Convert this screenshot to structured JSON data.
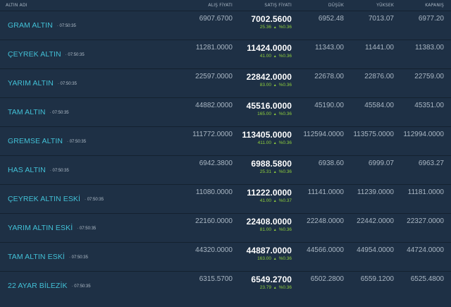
{
  "header": {
    "name": "ALTIN ADI",
    "buy": "ALIŞ FİYATI",
    "sell": "SATIŞ FİYATI",
    "low": "DÜŞÜK",
    "high": "YÜKSEK",
    "close": "KAPANIŞ"
  },
  "colors": {
    "background": "#1e3045",
    "name": "#42c0d6",
    "change": "#8fcf3c"
  },
  "change_icon": "triangle-up-icon",
  "rows": [
    {
      "name": "GRAM ALTIN",
      "time": "· 07:50:35",
      "buy": "6907.6700",
      "sell": "7002.5600",
      "change": "25.36",
      "pct": "%0.36",
      "low": "6952.48",
      "high": "7013.07",
      "close": "6977.20"
    },
    {
      "name": "ÇEYREK ALTIN",
      "time": "· 07:50:35",
      "buy": "11281.0000",
      "sell": "11424.0000",
      "change": "41.00",
      "pct": "%0.36",
      "low": "11343.00",
      "high": "11441.00",
      "close": "11383.00"
    },
    {
      "name": "YARIM ALTIN",
      "time": "· 07:50:35",
      "buy": "22597.0000",
      "sell": "22842.0000",
      "change": "83.00",
      "pct": "%0.36",
      "low": "22678.00",
      "high": "22876.00",
      "close": "22759.00"
    },
    {
      "name": "TAM ALTIN",
      "time": "· 07:50:35",
      "buy": "44882.0000",
      "sell": "45516.0000",
      "change": "165.00",
      "pct": "%0.36",
      "low": "45190.00",
      "high": "45584.00",
      "close": "45351.00"
    },
    {
      "name": "GREMSE ALTIN",
      "time": "· 07:50:35",
      "buy": "111772.0000",
      "sell": "113405.0000",
      "change": "411.00",
      "pct": "%0.36",
      "low": "112594.0000",
      "high": "113575.0000",
      "close": "112994.0000"
    },
    {
      "name": "HAS ALTIN",
      "time": "· 07:50:35",
      "buy": "6942.3800",
      "sell": "6988.5800",
      "change": "25.31",
      "pct": "%0.36",
      "low": "6938.60",
      "high": "6999.07",
      "close": "6963.27"
    },
    {
      "name": "ÇEYREK ALTIN ESKİ",
      "time": "· 07:50:35",
      "buy": "11080.0000",
      "sell": "11222.0000",
      "change": "41.00",
      "pct": "%0.37",
      "low": "11141.0000",
      "high": "11239.0000",
      "close": "11181.0000"
    },
    {
      "name": "YARIM ALTIN ESKİ",
      "time": "· 07:50:35",
      "buy": "22160.0000",
      "sell": "22408.0000",
      "change": "81.00",
      "pct": "%0.36",
      "low": "22248.0000",
      "high": "22442.0000",
      "close": "22327.0000"
    },
    {
      "name": "TAM ALTIN ESKİ",
      "time": "· 07:50:35",
      "buy": "44320.0000",
      "sell": "44887.0000",
      "change": "163.00",
      "pct": "%0.36",
      "low": "44566.0000",
      "high": "44954.0000",
      "close": "44724.0000"
    },
    {
      "name": "22 AYAR BİLEZİK",
      "time": "· 07:50:35",
      "buy": "6315.5700",
      "sell": "6549.2700",
      "change": "23.79",
      "pct": "%0.36",
      "low": "6502.2800",
      "high": "6559.1200",
      "close": "6525.4800"
    }
  ]
}
